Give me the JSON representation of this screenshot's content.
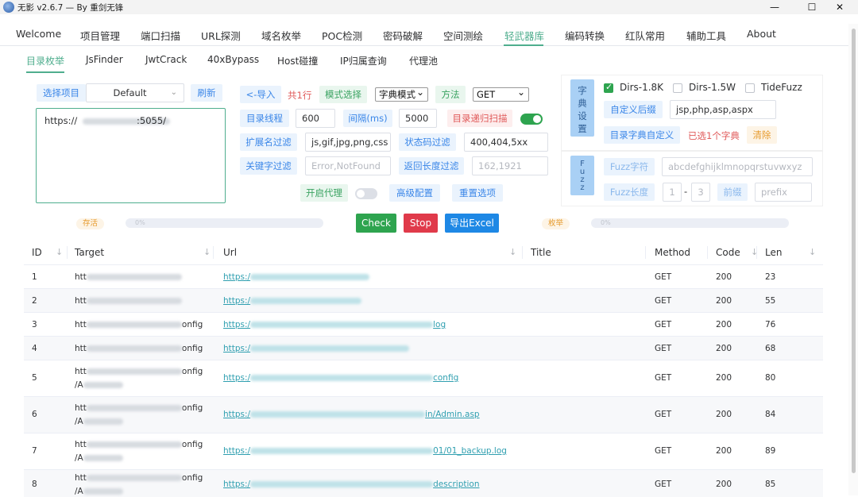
{
  "window": {
    "title": "无影 v2.6.7 — By 重剑无锋",
    "min": "—",
    "max": "☐",
    "close": "✕"
  },
  "main_tabs": [
    "Welcome",
    "项目管理",
    "端口扫描",
    "URL探测",
    "域名枚举",
    "POC检测",
    "密码破解",
    "空间测绘",
    "轻武器库",
    "编码转换",
    "红队常用",
    "辅助工具",
    "About"
  ],
  "main_active": "轻武器库",
  "sub_tabs": [
    "目录枚举",
    "JsFinder",
    "JwtCrack",
    "40xBypass",
    "Host碰撞",
    "IP归属查询",
    "代理池"
  ],
  "sub_active": "目录枚举",
  "project": {
    "select_label": "选择项目",
    "value": "Default",
    "refresh": "刷新",
    "url_text": "https://",
    "url_suffix": ":5055/"
  },
  "controls": {
    "import": "<-导入",
    "count": "共1行",
    "mode_label": "模式选择",
    "mode_value": "字典模式",
    "method_label": "方法",
    "method_value": "GET",
    "threads_label": "目录线程",
    "threads_value": "600",
    "interval_label": "间隔(ms)",
    "interval_value": "5000",
    "recursive_label": "目录递归扫描",
    "ext_filter_label": "扩展名过滤",
    "ext_filter_value": "js,gif,jpg,png,css",
    "code_filter_label": "状态码过滤",
    "code_filter_value": "400,404,5xx",
    "keyword_filter_label": "关键字过滤",
    "keyword_filter_placeholder": "Error,NotFound",
    "len_filter_label": "返回长度过滤",
    "len_filter_placeholder": "162,1921",
    "proxy_label": "开启代理",
    "advanced": "高级配置",
    "reset": "重置选项"
  },
  "dict": {
    "label": "字典设置",
    "opt1": "Dirs-1.8K",
    "opt2": "Dirs-1.5W",
    "opt3": "TideFuzz",
    "suffix_label": "自定义后缀",
    "suffix_value": "jsp,php,asp,aspx",
    "custom_label": "目录字典自定义",
    "selected": "已选1个字典",
    "clear": "清除"
  },
  "fuzz": {
    "label": "Fuzz",
    "chars_label": "Fuzz字符",
    "chars_value": "abcdefghijklmnopqrstuvwxyz",
    "len_label": "Fuzz长度",
    "len_min": "1",
    "len_sep": "-",
    "len_max": "3",
    "prefix_label": "前缀",
    "prefix_placeholder": "prefix"
  },
  "progress": {
    "left_label": "存活",
    "right_label": "枚举",
    "left_text": "0%",
    "right_text": "0%"
  },
  "actions": {
    "check": "Check",
    "stop": "Stop",
    "export": "导出Excel"
  },
  "colors": {
    "accent": "#4fae8e",
    "check": "#2ea44f",
    "stop": "#e03a4a",
    "export": "#1e88e5"
  },
  "table": {
    "headers": [
      "ID",
      "Target",
      "Url",
      "Title",
      "Method",
      "Code",
      "Len"
    ],
    "rows": [
      {
        "id": "1",
        "target": "htt",
        "target2": "",
        "url_pre": "https:/",
        "url_post": "",
        "method": "GET",
        "code": "200",
        "len": "23"
      },
      {
        "id": "2",
        "target": "htt",
        "target2": "",
        "url_pre": "https:/",
        "url_post": "",
        "method": "GET",
        "code": "200",
        "len": "55"
      },
      {
        "id": "3",
        "target": "htt",
        "target_suffix": "onfig",
        "target2": "",
        "url_pre": "https:/",
        "url_post": "log",
        "method": "GET",
        "code": "200",
        "len": "76"
      },
      {
        "id": "4",
        "target": "htt",
        "target_suffix": "onfig",
        "target2": "",
        "url_pre": "https:/",
        "url_post": "",
        "method": "GET",
        "code": "200",
        "len": "68"
      },
      {
        "id": "5",
        "target": "htt",
        "target_suffix": "onfig",
        "target2": "/A",
        "url_pre": "https:/",
        "url_post": "config",
        "method": "GET",
        "code": "200",
        "len": "80"
      },
      {
        "id": "6",
        "target": "htt",
        "target_suffix": "onfig",
        "target2": "/A",
        "url_pre": "https:/",
        "url_post": "in/Admin.asp",
        "method": "GET",
        "code": "200",
        "len": "84"
      },
      {
        "id": "7",
        "target": "htt",
        "target_suffix": "onfig",
        "target2": "/A",
        "url_pre": "https:/",
        "url_post": "01/01_backup.log",
        "method": "GET",
        "code": "200",
        "len": "89"
      },
      {
        "id": "8",
        "target": "htt",
        "target_suffix": "onfig",
        "target2": "/A",
        "url_pre": "https:/",
        "url_post": "description",
        "method": "GET",
        "code": "200",
        "len": "85"
      }
    ]
  }
}
